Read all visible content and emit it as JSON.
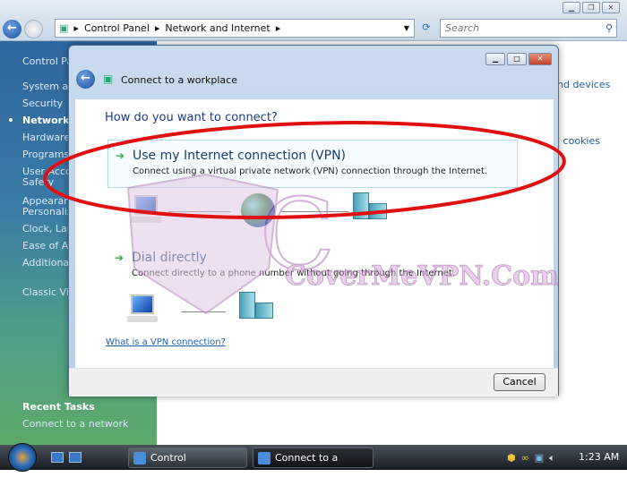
{
  "explorer": {
    "breadcrumb": [
      "Control Panel",
      "Network and Internet"
    ],
    "search_placeholder": "Search",
    "sidebar": {
      "home": "Control Pa",
      "items": [
        "System and",
        "Security",
        "Network a",
        "Hardware",
        "Programs",
        "User Accou\nSafety",
        "Appearanc\nPersonaliza",
        "Clock, Lang",
        "Ease of Acc",
        "Additional"
      ],
      "active_index": 2,
      "classic_view": "Classic Vie",
      "recent_tasks_title": "Recent Tasks",
      "recent_tasks": [
        "Connect to a network"
      ]
    },
    "right_fragments": [
      "nd devices",
      "l cookies"
    ]
  },
  "dialog": {
    "title": "Connect to a workplace",
    "heading": "How do you want to connect?",
    "options": [
      {
        "title": "Use my Internet connection (VPN)",
        "description": "Connect using a virtual private network (VPN) connection through the Internet.",
        "selected": true
      },
      {
        "title": "Dial directly",
        "description": "Connect directly to a phone number without going through the Internet.",
        "selected": false
      }
    ],
    "help_link": "What is a VPN connection?",
    "cancel_label": "Cancel"
  },
  "watermark": {
    "text": "CoverMeVPN.Com",
    "color": "#d9a8dc"
  },
  "annotation": {
    "shape": "ellipse",
    "color": "#e01010"
  },
  "taskbar": {
    "tasks": [
      {
        "label": "Control Panel\\Netw...",
        "active": false
      },
      {
        "label": "Connect to a workpl...",
        "active": true
      }
    ],
    "clock": "1:23 AM"
  }
}
